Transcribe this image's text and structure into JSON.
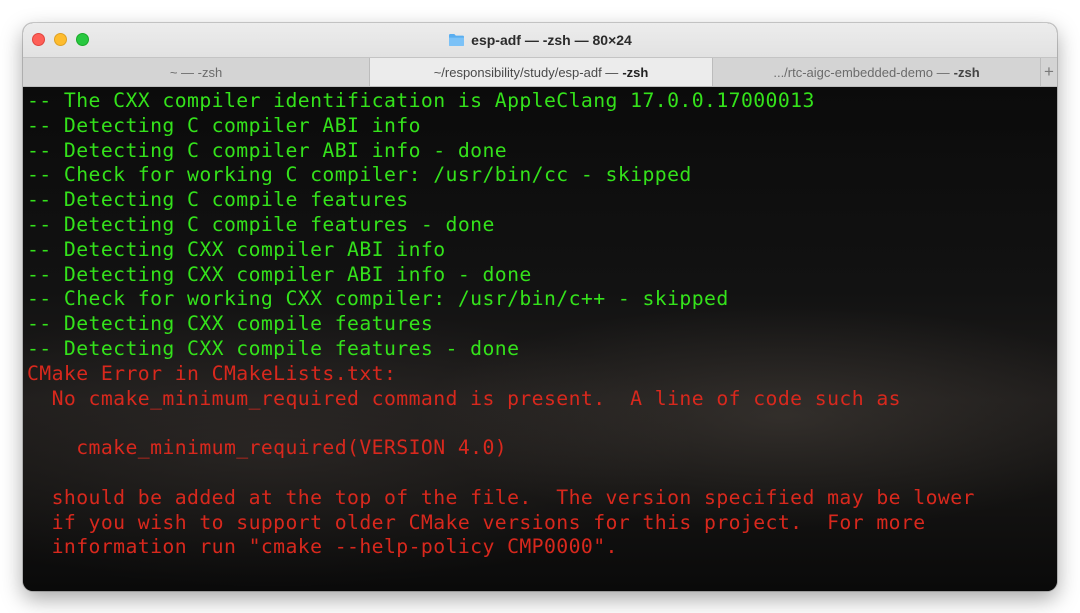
{
  "window": {
    "title": "esp-adf — -zsh — 80×24"
  },
  "tabs": [
    {
      "prefix": "~ — -zsh",
      "bold": "",
      "active": false
    },
    {
      "prefix": "~/responsibility/study/esp-adf —",
      "bold": "-zsh",
      "active": true
    },
    {
      "prefix": ".../rtc-aigc-embedded-demo —",
      "bold": "-zsh",
      "active": false
    }
  ],
  "new_tab_label": "+",
  "colors": {
    "ok": "#34e21b",
    "error": "#d8281d"
  },
  "terminal": {
    "lines": [
      {
        "type": "ok",
        "text": "-- The CXX compiler identification is AppleClang 17.0.0.17000013"
      },
      {
        "type": "ok",
        "text": "-- Detecting C compiler ABI info"
      },
      {
        "type": "ok",
        "text": "-- Detecting C compiler ABI info - done"
      },
      {
        "type": "ok",
        "text": "-- Check for working C compiler: /usr/bin/cc - skipped"
      },
      {
        "type": "ok",
        "text": "-- Detecting C compile features"
      },
      {
        "type": "ok",
        "text": "-- Detecting C compile features - done"
      },
      {
        "type": "ok",
        "text": "-- Detecting CXX compiler ABI info"
      },
      {
        "type": "ok",
        "text": "-- Detecting CXX compiler ABI info - done"
      },
      {
        "type": "ok",
        "text": "-- Check for working CXX compiler: /usr/bin/c++ - skipped"
      },
      {
        "type": "ok",
        "text": "-- Detecting CXX compile features"
      },
      {
        "type": "ok",
        "text": "-- Detecting CXX compile features - done"
      },
      {
        "type": "err",
        "text": "CMake Error in CMakeLists.txt:"
      },
      {
        "type": "err",
        "text": "  No cmake_minimum_required command is present.  A line of code such as"
      },
      {
        "type": "err",
        "text": ""
      },
      {
        "type": "err",
        "text": "    cmake_minimum_required(VERSION 4.0)"
      },
      {
        "type": "err",
        "text": ""
      },
      {
        "type": "err",
        "text": "  should be added at the top of the file.  The version specified may be lower"
      },
      {
        "type": "err",
        "text": "  if you wish to support older CMake versions for this project.  For more"
      },
      {
        "type": "err",
        "text": "  information run \"cmake --help-policy CMP0000\"."
      }
    ]
  }
}
